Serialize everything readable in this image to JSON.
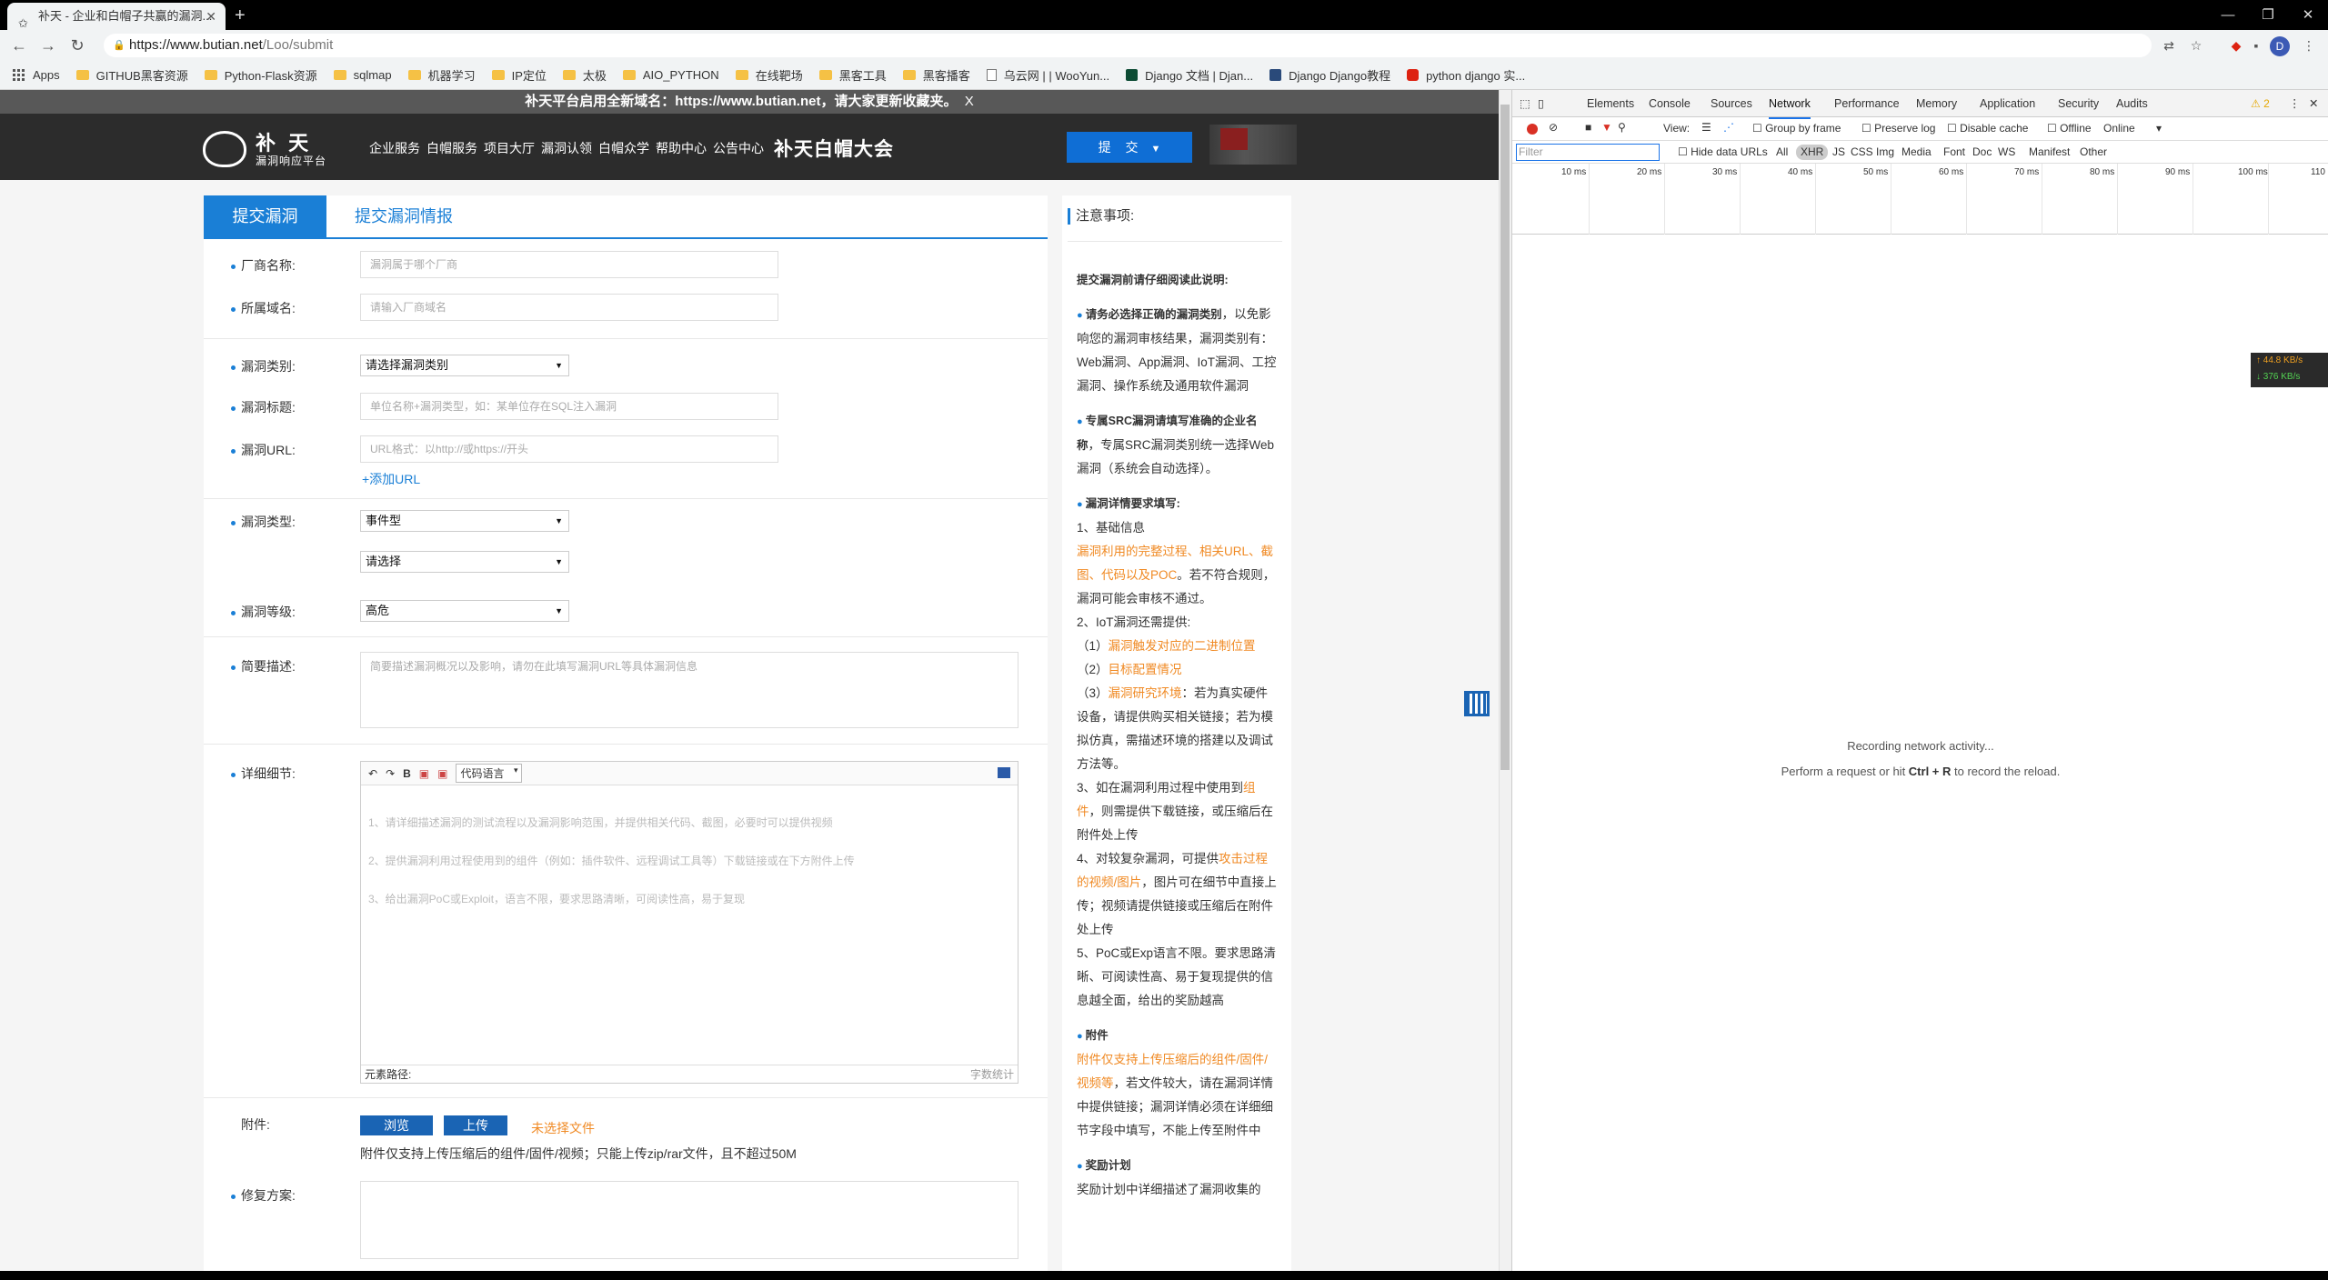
{
  "browser": {
    "tab_title": "补天 - 企业和白帽子共赢的漏洞...",
    "tab_favicon": "star-icon",
    "url_host": "https://www.butian.net",
    "url_path": "/Loo/submit",
    "window_controls": [
      "—",
      "❐",
      "✕"
    ]
  },
  "bookmarks": [
    {
      "label": "Apps",
      "icon": "apps-icon"
    },
    {
      "label": "GITHUB黑客资源",
      "icon": "folder-icon"
    },
    {
      "label": "Python-Flask资源",
      "icon": "folder-icon"
    },
    {
      "label": "sqlmap",
      "icon": "folder-icon"
    },
    {
      "label": "机器学习",
      "icon": "folder-icon"
    },
    {
      "label": "IP定位",
      "icon": "folder-icon"
    },
    {
      "label": "太极",
      "icon": "folder-icon"
    },
    {
      "label": "AIO_PYTHON",
      "icon": "folder-icon"
    },
    {
      "label": "在线靶场",
      "icon": "folder-icon"
    },
    {
      "label": "黑客工具",
      "icon": "folder-icon"
    },
    {
      "label": "黑客播客",
      "icon": "folder-icon"
    },
    {
      "label": "乌云网 | | WooYun...",
      "icon": "page-icon"
    },
    {
      "label": "Django 文档 | Djan...",
      "icon": "django-icon"
    },
    {
      "label": "Django Django教程",
      "icon": "liaoxuefeng-icon"
    },
    {
      "label": "python django 实...",
      "icon": "csdn-icon"
    }
  ],
  "site": {
    "announcement": "补天平台启用全新域名：https://www.butian.net，请大家更新收藏夹。",
    "announcement_close": "X",
    "logo_name": "补 天",
    "logo_sub": "漏洞响应平台",
    "nav": [
      "企业服务",
      "白帽服务",
      "项目大厅",
      "漏洞认领",
      "白帽众学",
      "帮助中心",
      "公告中心"
    ],
    "nav_big": "补天白帽大会",
    "submit_button": "提 交"
  },
  "form": {
    "tabs": [
      "提交漏洞",
      "提交漏洞情报"
    ],
    "vendor_label": "厂商名称:",
    "vendor_placeholder": "漏洞属于哪个厂商",
    "domain_label": "所属域名:",
    "domain_placeholder": "请输入厂商域名",
    "category_label": "漏洞类别:",
    "category_value": "请选择漏洞类别",
    "title_label": "漏洞标题:",
    "title_placeholder": "单位名称+漏洞类型，如：某单位存在SQL注入漏洞",
    "url_label": "漏洞URL:",
    "url_placeholder": "URL格式：以http://或https://开头",
    "add_url": "+添加URL",
    "type_label": "漏洞类型:",
    "type_value": "事件型",
    "subtype_value": "请选择",
    "level_label": "漏洞等级:",
    "level_value": "高危",
    "summary_label": "简要描述:",
    "summary_placeholder": "简要描述漏洞概况以及影响，请勿在此填写漏洞URL等具体漏洞信息",
    "detail_label": "详细细节:",
    "editor_lang": "代码语言",
    "editor_lines": [
      "1、请详细描述漏洞的测试流程以及漏洞影响范围，并提供相关代码、截图，必要时可以提供视频",
      "2、提供漏洞利用过程使用到的组件（例如：插件软件、远程调试工具等）下载链接或在下方附件上传",
      "3、给出漏洞PoC或Exploit，语言不限，要求思路清晰，可阅读性高，易于复现"
    ],
    "editor_path": "元素路径:",
    "editor_wordcount": "字数统计",
    "attachment_label": "附件:",
    "browse_button": "浏览",
    "upload_button": "上传",
    "no_file": "未选择文件",
    "attachment_note": "附件仅支持上传压缩后的组件/固件/视频；只能上传zip/rar文件，且不超过50M",
    "fix_label": "修复方案:"
  },
  "notes": {
    "title": "注意事项:",
    "intro": "提交漏洞前请仔细阅读此说明:",
    "p1_bold": "请务必选择正确的漏洞类别",
    "p1_rest": "，以免影响您的漏洞审核结果，漏洞类别有：Web漏洞、App漏洞、IoT漏洞、工控漏洞、操作系统及通用软件漏洞",
    "p2_bold": "专属SRC漏洞请填写准确的企业名称",
    "p2_rest": "，专属SRC漏洞类别统一选择Web漏洞（系统会自动选择）。",
    "p3_bold": "漏洞详情要求填写:",
    "p3_l1": "1、基础信息",
    "p3_l1_orange": "漏洞利用的完整过程、相关URL、截图、代码以及POC",
    "p3_l1_rest": "。若不符合规则，漏洞可能会审核不通过。",
    "p3_l2": "2、IoT漏洞还需提供:",
    "p3_l2a_pre": "（1）",
    "p3_l2a": "漏洞触发对应的二进制位置",
    "p3_l2b_pre": "（2）",
    "p3_l2b": "目标配置情况",
    "p3_l2c_pre": "（3）",
    "p3_l2c": "漏洞研究环境",
    "p3_l2c_rest": "：若为真实硬件设备，请提供购买相关链接；若为模拟仿真，需描述环境的搭建以及调试方法等。",
    "p3_l3_pre": "3、如在漏洞利用过程中使用到",
    "p3_l3_orange": "组件",
    "p3_l3_rest": "，则需提供下载链接，或压缩后在附件处上传",
    "p3_l4_pre": "4、对较复杂漏洞，可提供",
    "p3_l4_orange": "攻击过程的视频/图片",
    "p3_l4_rest": "，图片可在细节中直接上传；视频请提供链接或压缩后在附件处上传",
    "p3_l5": "5、PoC或Exp语言不限。要求思路清晰、可阅读性高、易于复现提供的信息越全面，给出的奖励越高",
    "p4_bold": "附件",
    "p4_orange": "附件仅支持上传压缩后的组件/固件/视频等",
    "p4_rest": "，若文件较大，请在漏洞详情中提供链接；漏洞详情必须在详细细节字段中填写，不能上传至附件中",
    "p5_bold": "奖励计划",
    "p5_rest": "奖励计划中详细描述了漏洞收集的"
  },
  "devtools": {
    "tabs": [
      "Elements",
      "Console",
      "Sources",
      "Network",
      "Performance",
      "Memory",
      "Application",
      "Security",
      "Audits"
    ],
    "active_tab": "Network",
    "warnings": "⚠ 2",
    "view_label": "View:",
    "group_by_frame": "Group by frame",
    "preserve_log": "Preserve log",
    "disable_cache": "Disable cache",
    "offline": "Offline",
    "throttle": "Online",
    "filter_placeholder": "Filter",
    "hide_data_urls": "Hide data URLs",
    "type_filters": [
      "All",
      "XHR",
      "JS",
      "CSS",
      "Img",
      "Media",
      "Font",
      "Doc",
      "WS",
      "Manifest",
      "Other"
    ],
    "timeline_ticks": [
      "10 ms",
      "20 ms",
      "30 ms",
      "40 ms",
      "50 ms",
      "60 ms",
      "70 ms",
      "80 ms",
      "90 ms",
      "100 ms",
      "110"
    ],
    "recording_line1": "Recording network activity...",
    "recording_pre": "Perform a request or hit ",
    "recording_keys": "Ctrl + R",
    "recording_post": " to record the reload.",
    "speed_up": "↑ 44.8 KB/s",
    "speed_down": "↓ 376 KB/s"
  }
}
